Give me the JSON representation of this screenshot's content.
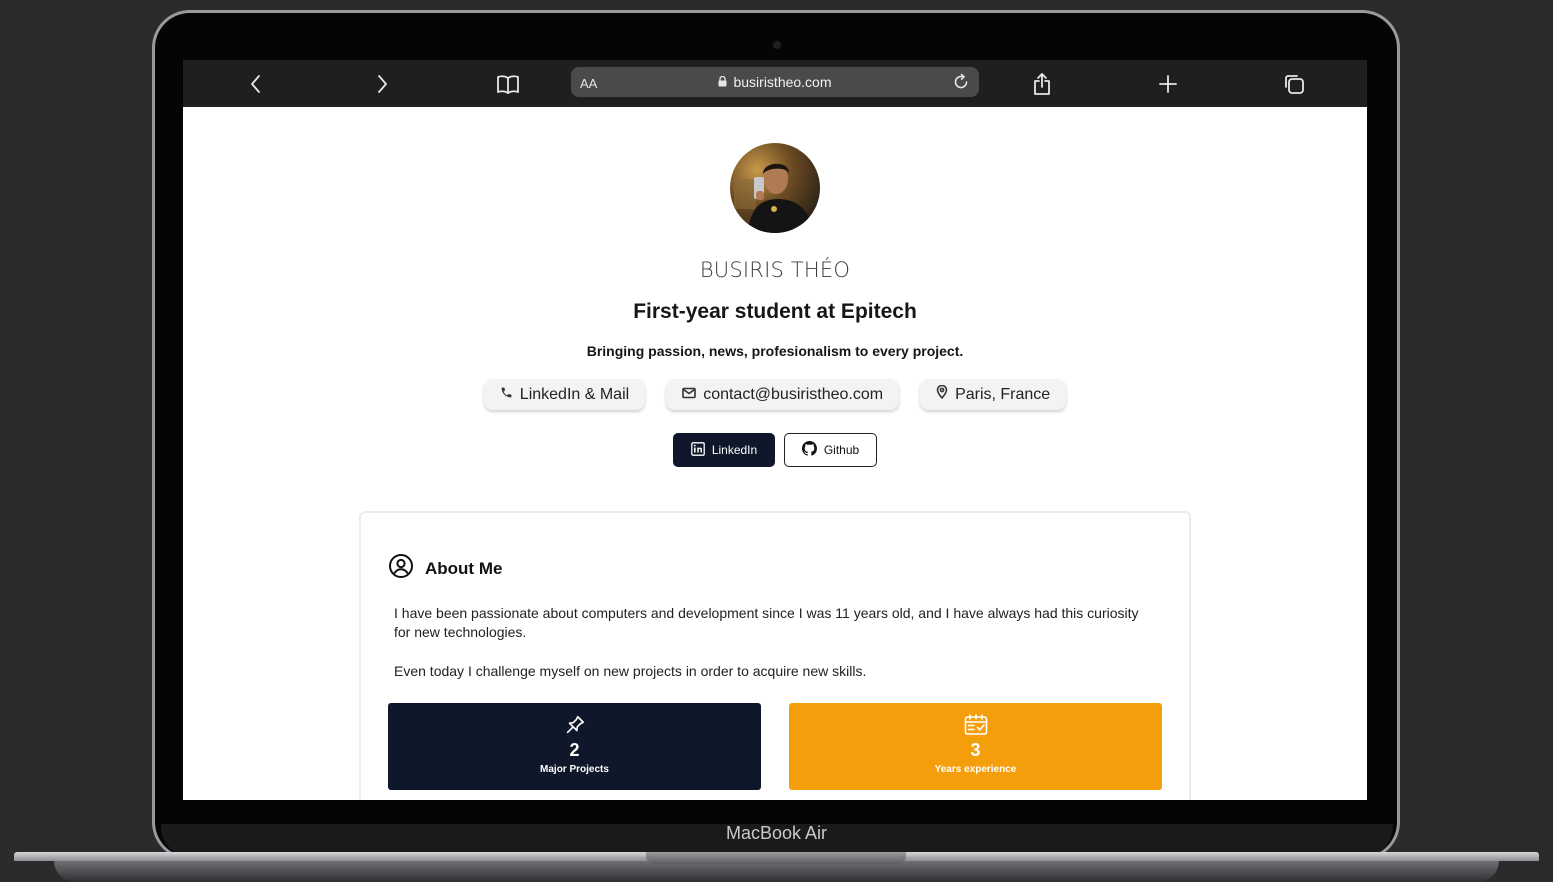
{
  "device": {
    "brand_label": "MacBook Air"
  },
  "browser": {
    "text_size_label": "AA",
    "url": "busiristheo.com",
    "icons": [
      "back-icon",
      "forward-icon",
      "bookmarks-icon",
      "lock-icon",
      "reload-icon",
      "share-icon",
      "new-tab-icon",
      "tabs-icon"
    ]
  },
  "profile": {
    "name": "BUSIRIS THÉO",
    "role": "First-year student at Epitech",
    "tagline": "Bringing passion, news, profesionalism to every project."
  },
  "chips": {
    "phone": "LinkedIn & Mail",
    "email": "contact@busiristheo.com",
    "location": "Paris, France"
  },
  "socials": {
    "linkedin": "LinkedIn",
    "github": "Github"
  },
  "about": {
    "title": "About Me",
    "paragraph1": "I have been passionate about computers and development since I was 11 years old, and I have always had this curiosity for new technologies.",
    "paragraph2": "Even today I challenge myself on new projects in order to acquire new skills."
  },
  "stats": {
    "projects": {
      "value": "2",
      "label": "Major Projects",
      "color": "#0f172a"
    },
    "experience": {
      "value": "3",
      "label": "Years experience",
      "color": "#f59e0b"
    }
  }
}
